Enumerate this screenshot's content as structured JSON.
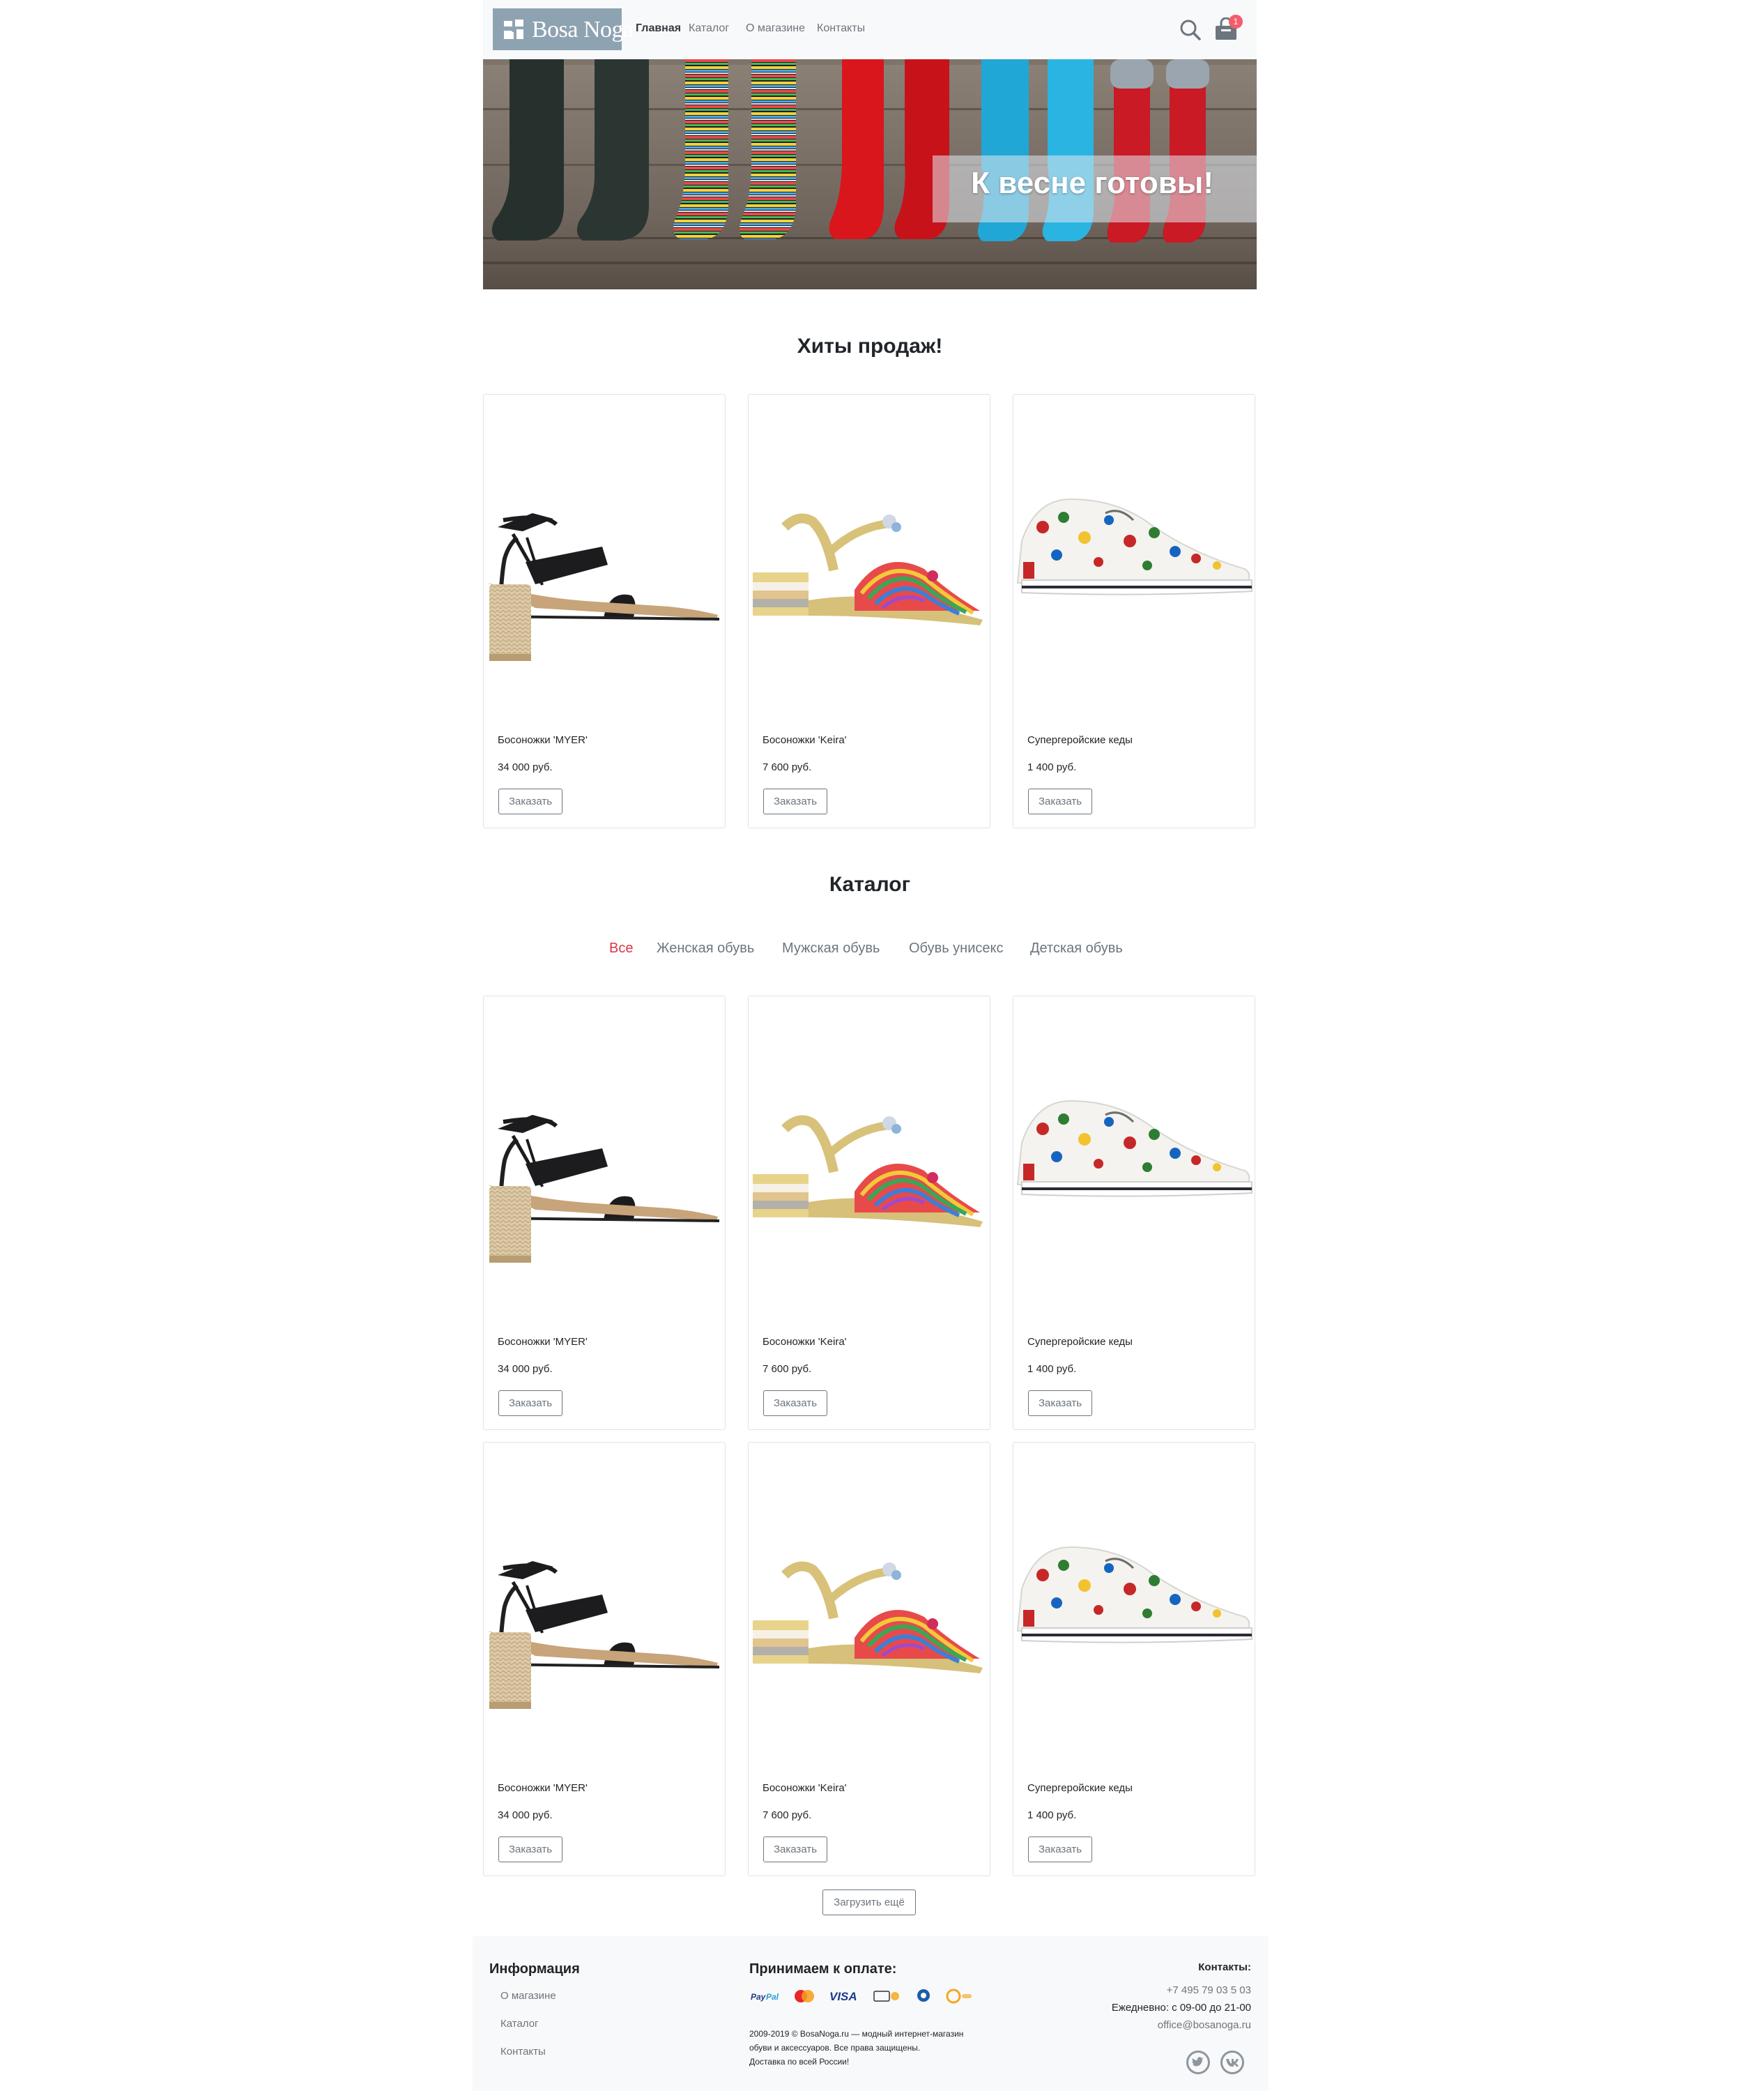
{
  "brand": {
    "logo_text": "Bosa Noga",
    "logo_alt": "Bosa Noga"
  },
  "nav": {
    "items": [
      "Главная",
      "Каталог",
      "О магазине",
      "Контакты"
    ],
    "active": "Главная"
  },
  "cart": {
    "count": "1"
  },
  "banner": {
    "title": "К весне готовы!"
  },
  "top_sales": {
    "title": "Хиты продаж!",
    "products": [
      {
        "name": "Босоножки 'MYER'",
        "price": "34 000 руб.",
        "button": "Заказать",
        "image": "black-strappy-sandal"
      },
      {
        "name": "Босоножки 'Keira'",
        "price": "7 600 руб.",
        "button": "Заказать",
        "image": "gold-rainbow-sandal"
      },
      {
        "name": "Супергеройские кеды",
        "price": "1 400 руб.",
        "button": "Заказать",
        "image": "superhero-sneaker"
      }
    ]
  },
  "catalog": {
    "title": "Каталог",
    "categories": [
      "Все",
      "Женская обувь",
      "Мужская обувь",
      "Обувь унисекс",
      "Детская обувь"
    ],
    "active_category": "Все",
    "products": [
      {
        "name": "Босоножки 'MYER'",
        "price": "34 000 руб.",
        "button": "Заказать",
        "image": "black-strappy-sandal"
      },
      {
        "name": "Босоножки 'Keira'",
        "price": "7 600 руб.",
        "button": "Заказать",
        "image": "gold-rainbow-sandal"
      },
      {
        "name": "Супергеройские кеды",
        "price": "1 400 руб.",
        "button": "Заказать",
        "image": "superhero-sneaker"
      },
      {
        "name": "Босоножки 'MYER'",
        "price": "34 000 руб.",
        "button": "Заказать",
        "image": "black-strappy-sandal"
      },
      {
        "name": "Босоножки 'Keira'",
        "price": "7 600 руб.",
        "button": "Заказать",
        "image": "gold-rainbow-sandal"
      },
      {
        "name": "Супергеройские кеды",
        "price": "1 400 руб.",
        "button": "Заказать",
        "image": "superhero-sneaker"
      }
    ],
    "load_more": "Загрузить ещё"
  },
  "footer": {
    "info_title": "Информация",
    "info_links": [
      "О магазине",
      "Каталог",
      "Контакты"
    ],
    "payment_title": "Принимаем к оплате:",
    "payment_methods": [
      "PayPal",
      "MasterCard",
      "VISA",
      "Яндекс Деньги",
      "WebMoney",
      "QIWI"
    ],
    "copyright_lines": [
      "2009-2019 © BosaNoga.ru — модный интернет-магазин",
      "обуви и аксессуаров. Все права защищены.",
      "Доставка по всей России!"
    ],
    "contacts_title": "Контакты:",
    "phone": "+7 495 79 03 5 03",
    "hours": "Ежедневно: с 09-00 до 21-00",
    "email": "office@bosanoga.ru",
    "social": [
      "twitter-icon",
      "vk-icon"
    ]
  },
  "colors": {
    "accent": "#dc3545",
    "badge": "#f25e6c",
    "logo_bg": "#8ea3b1",
    "footer_bg": "#f8f9fa",
    "muted": "#6c757d"
  }
}
